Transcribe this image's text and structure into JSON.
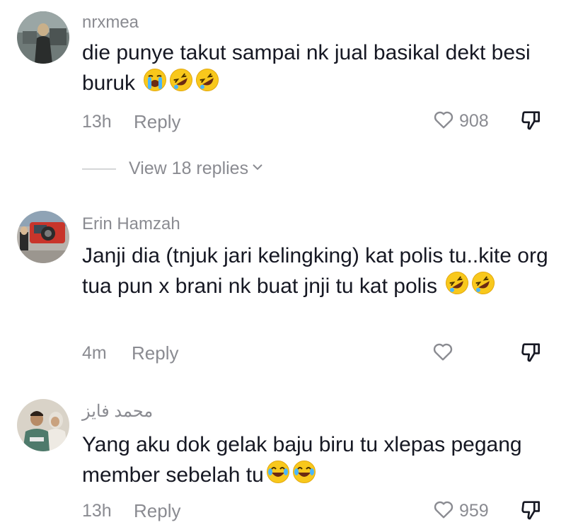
{
  "comments": [
    {
      "username": "nrxmea",
      "text": "die punye takut sampai nk jual basikal dekt besi buruk",
      "emojis": [
        "loudly-crying-face",
        "rolling-on-floor-laughing",
        "rolling-on-floor-laughing"
      ],
      "time": "13h",
      "reply_label": "Reply",
      "likes": "908",
      "view_replies": "View 18 replies"
    },
    {
      "username": "Erin Hamzah",
      "text": "Janji dia (tnjuk jari kelingking) kat polis tu..kite org tua pun x brani nk buat jnji tu kat polis",
      "emojis": [
        "rolling-on-floor-laughing",
        "rolling-on-floor-laughing"
      ],
      "time": "4m",
      "reply_label": "Reply",
      "likes": ""
    },
    {
      "username": "محمد فايز",
      "text": "Yang aku dok gelak baju biru tu xlepas pegang member sebelah tu",
      "emojis": [
        "face-with-tears-of-joy",
        "face-with-tears-of-joy"
      ],
      "time": "13h",
      "reply_label": "Reply",
      "likes": "959"
    }
  ],
  "icons": {
    "like": "heart-outline-icon",
    "dislike": "thumbs-down-outline-icon",
    "expand": "chevron-down-icon"
  },
  "colors": {
    "text": "#161823",
    "muted": "#8a8b91",
    "emoji_yellow": "#f8c81c"
  }
}
